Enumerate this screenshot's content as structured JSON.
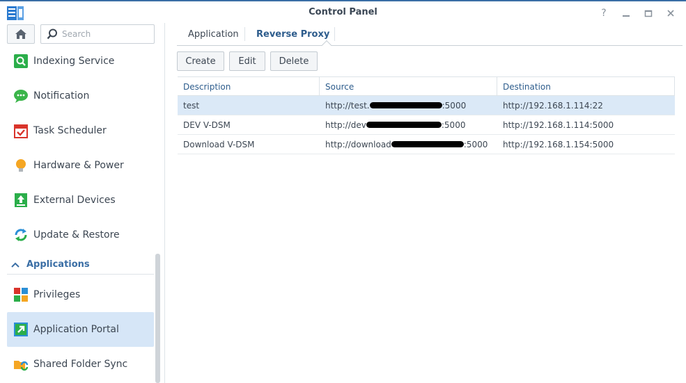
{
  "window": {
    "title": "Control Panel"
  },
  "search": {
    "placeholder": "Search"
  },
  "sidebar": {
    "items": [
      {
        "label": "Indexing Service",
        "icon": "indexing-service-icon"
      },
      {
        "label": "Notification",
        "icon": "notification-icon"
      },
      {
        "label": "Task Scheduler",
        "icon": "task-scheduler-icon"
      },
      {
        "label": "Hardware & Power",
        "icon": "hardware-power-icon"
      },
      {
        "label": "External Devices",
        "icon": "external-devices-icon"
      },
      {
        "label": "Update & Restore",
        "icon": "update-restore-icon"
      }
    ],
    "section": {
      "label": "Applications"
    },
    "app_items": [
      {
        "label": "Privileges",
        "icon": "privileges-icon"
      },
      {
        "label": "Application Portal",
        "icon": "application-portal-icon",
        "active": true
      },
      {
        "label": "Shared Folder Sync",
        "icon": "shared-folder-sync-icon"
      }
    ]
  },
  "tabs": [
    {
      "label": "Application"
    },
    {
      "label": "Reverse Proxy",
      "active": true
    }
  ],
  "toolbar": {
    "create": "Create",
    "edit": "Edit",
    "delete": "Delete"
  },
  "table": {
    "columns": [
      "Description",
      "Source",
      "Destination"
    ],
    "rows": [
      {
        "description": "test",
        "source_prefix": "http://test.",
        "source_suffix": ":5000",
        "destination": "http://192.168.1.114:22",
        "selected": true
      },
      {
        "description": "DEV V-DSM",
        "source_prefix": "http://dev",
        "source_suffix": ":5000",
        "destination": "http://192.168.1.114:5000"
      },
      {
        "description": "Download V-DSM",
        "source_prefix": "http://download",
        "source_suffix": ":5000",
        "destination": "http://192.168.1.154:5000"
      }
    ]
  },
  "colors": {
    "accent": "#3a6ea5",
    "selection": "#d6e6f7"
  }
}
